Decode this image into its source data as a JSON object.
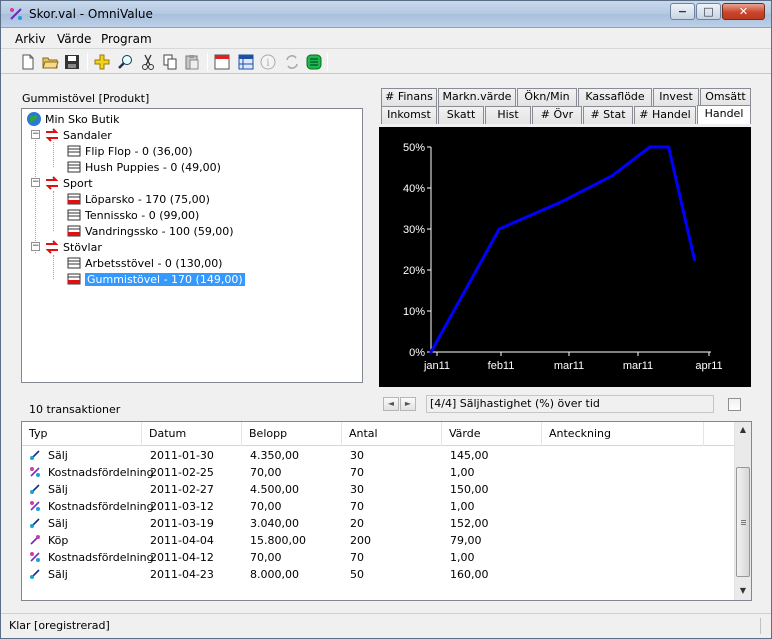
{
  "window": {
    "title": "Skor.val - OmniValue",
    "controls": {
      "minimize": "−",
      "maximize": "□",
      "close": "✕"
    }
  },
  "menu": [
    {
      "label": "Arkiv"
    },
    {
      "label": "Värde"
    },
    {
      "label": "Program"
    }
  ],
  "toolbar": [
    {
      "name": "new-document-icon"
    },
    {
      "name": "open-folder-icon"
    },
    {
      "name": "save-disk-icon"
    },
    {
      "name": "add-plus-icon"
    },
    {
      "name": "search-magnifier-icon"
    },
    {
      "name": "cut-scissors-icon"
    },
    {
      "name": "copy-icon"
    },
    {
      "name": "paste-icon"
    },
    {
      "name": "calendar-icon"
    },
    {
      "name": "report-table-icon"
    },
    {
      "name": "info-icon"
    },
    {
      "name": "refresh-arrows-icon"
    },
    {
      "name": "green-list-icon"
    }
  ],
  "tree": {
    "label": "Gummistövel  [Produkt]",
    "root": "Min Sko Butik",
    "groups": [
      {
        "label": "Sandaler",
        "items": [
          "Flip Flop - 0 (36,00)",
          "Hush Puppies - 0 (49,00)"
        ]
      },
      {
        "label": "Sport",
        "items": [
          "Löparsko - 170 (75,00)",
          "Tennissko - 0 (99,00)",
          "Vandringssko - 100 (59,00)"
        ]
      },
      {
        "label": "Stövlar",
        "items": [
          "Arbetsstövel - 0 (130,00)",
          "Gummistövel - 170 (149,00)"
        ]
      }
    ],
    "selected": "Gummistövel - 170 (149,00)"
  },
  "tabs": {
    "row_top": [
      "# Finans",
      "Markn.värde",
      "Ökn/Min",
      "Kassaflöde",
      "Invest",
      "Omsätt"
    ],
    "row_bottom": [
      "Inkomst",
      "Skatt",
      "Hist",
      "# Övr",
      "# Stat",
      "# Handel",
      "Handel"
    ],
    "active": "Handel"
  },
  "chart_data": {
    "type": "line",
    "x": [
      "2011-01-01",
      "2011-01-30",
      "2011-02-25",
      "2011-03-19",
      "2011-04-04",
      "2011-04-12",
      "2011-04-23"
    ],
    "y": [
      0,
      30,
      36.5,
      43,
      50,
      50,
      22.5
    ],
    "x_tick_labels": [
      "jan11",
      "feb11",
      "mar11",
      "mar11",
      "apr11"
    ],
    "y_tick_labels": [
      "0%",
      "10%",
      "20%",
      "30%",
      "40%",
      "50%"
    ],
    "ylim": [
      0,
      50
    ],
    "series_color": "#0000ff",
    "background": "#000000",
    "grid": false,
    "title": "",
    "xlabel": "",
    "ylabel": ""
  },
  "chart_caption": "[4/4] Säljhastighet (%) över tid",
  "chart_nav": {
    "prev": "◄",
    "next": "►"
  },
  "transactions": {
    "count_label": "10 transaktioner",
    "columns": [
      "Typ",
      "Datum",
      "Belopp",
      "Antal",
      "Värde",
      "Anteckning"
    ],
    "rows": [
      {
        "type": "Sälj",
        "date": "2011-01-30",
        "amount": "4.350,00",
        "qty": "30",
        "value": "145,00",
        "note": "",
        "kind": "sell"
      },
      {
        "type": "Kostnadsfördelning",
        "date": "2011-02-25",
        "amount": "70,00",
        "qty": "70",
        "value": "1,00",
        "note": "",
        "kind": "cost"
      },
      {
        "type": "Sälj",
        "date": "2011-02-27",
        "amount": "4.500,00",
        "qty": "30",
        "value": "150,00",
        "note": "",
        "kind": "sell"
      },
      {
        "type": "Kostnadsfördelning",
        "date": "2011-03-12",
        "amount": "70,00",
        "qty": "70",
        "value": "1,00",
        "note": "",
        "kind": "cost"
      },
      {
        "type": "Sälj",
        "date": "2011-03-19",
        "amount": "3.040,00",
        "qty": "20",
        "value": "152,00",
        "note": "",
        "kind": "sell"
      },
      {
        "type": "Köp",
        "date": "2011-04-04",
        "amount": "15.800,00",
        "qty": "200",
        "value": "79,00",
        "note": "",
        "kind": "buy"
      },
      {
        "type": "Kostnadsfördelning",
        "date": "2011-04-12",
        "amount": "70,00",
        "qty": "70",
        "value": "1,00",
        "note": "",
        "kind": "cost"
      },
      {
        "type": "Sälj",
        "date": "2011-04-23",
        "amount": "8.000,00",
        "qty": "50",
        "value": "160,00",
        "note": "",
        "kind": "sell"
      }
    ]
  },
  "scroll": {
    "up": "▲",
    "down": "▼"
  },
  "status": {
    "text": "Klar [oregistrerad]"
  }
}
